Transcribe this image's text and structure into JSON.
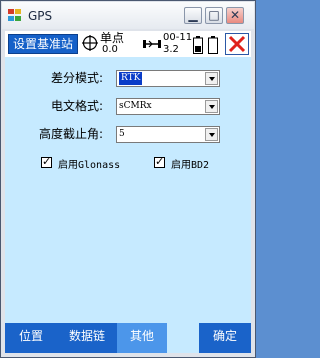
{
  "window": {
    "title": "GPS"
  },
  "status": {
    "station_button": "设置基准站",
    "fix_mode": "单点",
    "fix_value": "0.0",
    "link_code": "00-11",
    "link_value": "3.2",
    "icons": [
      "crosshair-icon",
      "antenna-link-icon",
      "battery-icon",
      "close-icon"
    ]
  },
  "form": {
    "diff_mode_label": "差分模式:",
    "diff_mode_value": "RTK",
    "msg_format_label": "电文格式:",
    "msg_format_value": "sCMRx",
    "elev_mask_label": "高度截止角:",
    "elev_mask_value": "5",
    "glonass_label": "启用Glonass",
    "bd2_label": "启用BD2",
    "glonass_checked": true,
    "bd2_checked": true
  },
  "tabs": {
    "position": "位置",
    "datalink": "数据链",
    "other": "其他",
    "ok": "确定"
  },
  "colors": {
    "accent": "#1a63c9",
    "client_bg": "#c6eaff",
    "active_tab": "#4c96ea",
    "close": "#e0211a"
  }
}
